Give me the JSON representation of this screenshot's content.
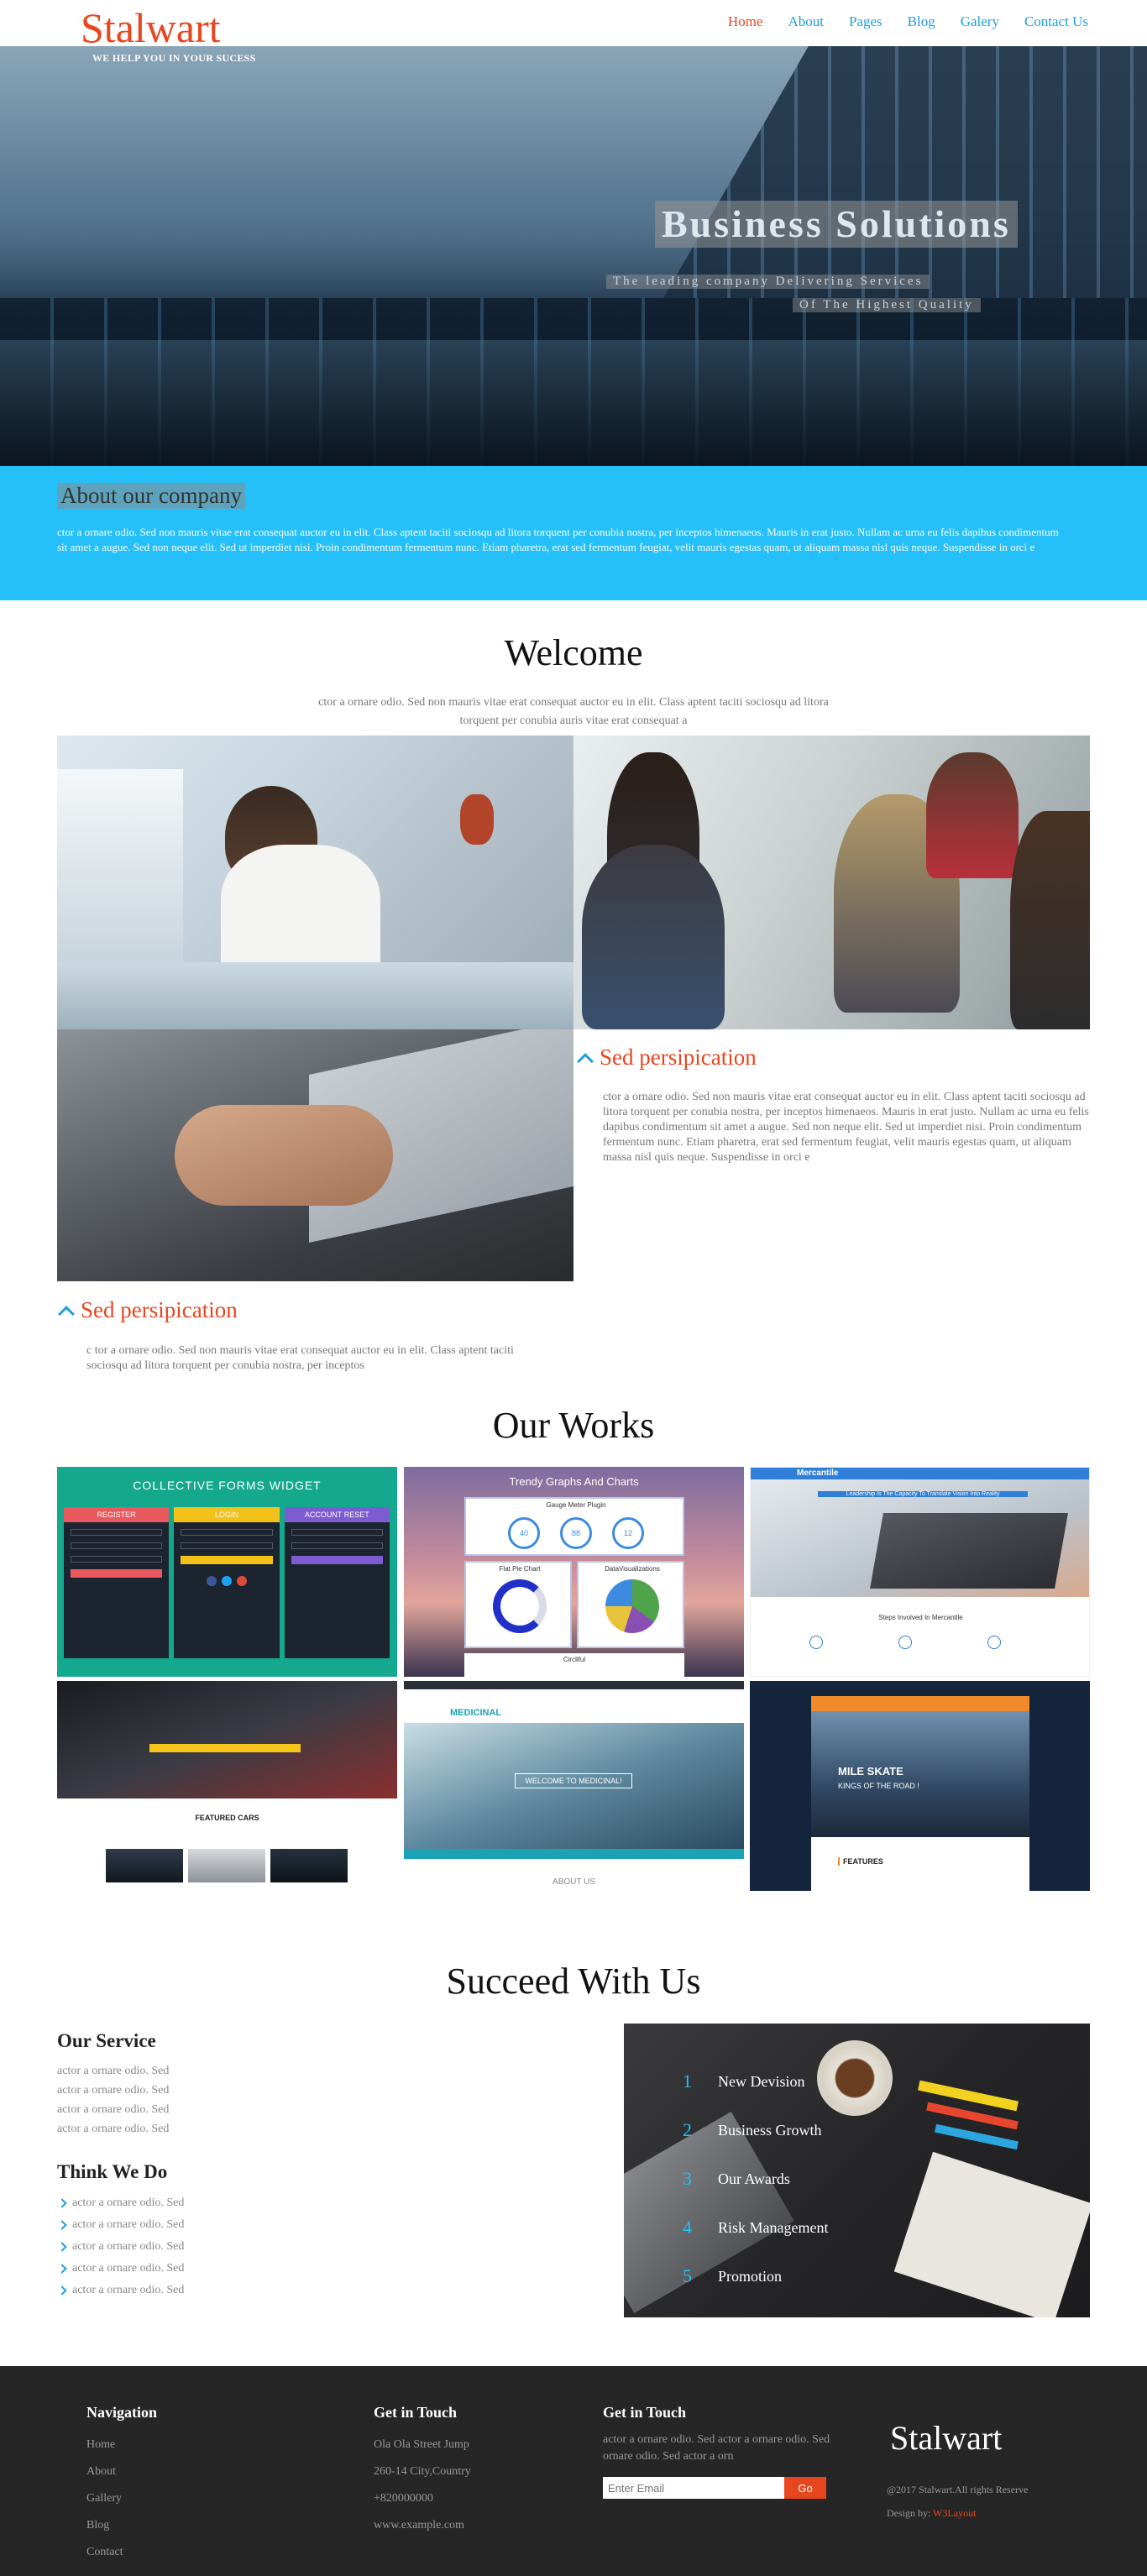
{
  "header": {
    "logo": "Stalwart",
    "tagline": "WE HELP YOU IN YOUR SUCESS",
    "nav": [
      "Home",
      "About",
      "Pages",
      "Blog",
      "Galery",
      "Contact Us"
    ]
  },
  "hero": {
    "title": "Business Solutions",
    "sub1": "The leading company Delivering Services",
    "sub2": "Of The Highest Quality"
  },
  "about": {
    "title": "About our company",
    "text": "ctor a ornare odio. Sed non mauris vitae erat consequat auctor eu in elit. Class aptent taciti sociosqu ad litora torquent per conubia nostra, per inceptos himenaeos. Mauris in erat justo. Nullam ac urna eu felis dapibus condimentum sit amet a augue. Sed non neque elit. Sed ut imperdiet nisi. Proin condimentum fermentum nunc. Etiam pharetra, erat sed fermentum feugiat, velit mauris egestas quam, ut aliquam massa nisl quis neque. Suspendisse in orci e"
  },
  "welcome": {
    "title": "Welcome",
    "intro": "ctor a ornare odio. Sed non mauris vitae erat consequat auctor eu in elit. Class aptent taciti sociosqu ad litora torquent per conubia auris vitae erat consequat a",
    "feature1": {
      "title": "Sed persipication",
      "text": "ctor a ornare odio. Sed non mauris vitae erat consequat auctor eu in elit. Class aptent taciti sociosqu ad litora torquent per conubia nostra, per inceptos himenaeos. Mauris in erat justo. Nullam ac urna eu felis dapibus condimentum sit amet a augue. Sed non neque elit. Sed ut imperdiet nisi. Proin condimentum fermentum nunc. Etiam pharetra, erat sed fermentum feugiat, velit mauris egestas quam, ut aliquam massa nisl quis neque. Suspendisse in orci e"
    },
    "feature2": {
      "title": "Sed persipication",
      "text": "c tor a ornare odio. Sed non mauris vitae erat consequat auctor eu in elit. Class aptent taciti sociosqu ad litora torquent per conubia nostra, per inceptos"
    }
  },
  "works": {
    "title": "Our Works",
    "w1": {
      "heading": "COLLECTIVE FORMS WIDGET",
      "tabs": [
        "REGISTER",
        "LOGIN",
        "ACCOUNT RESET"
      ]
    },
    "w2": {
      "heading": "Trendy Graphs And Charts",
      "g1": "Gauge Meter Plugin",
      "g2": "Flat Pie Chart",
      "g3": "DataVisualizations",
      "g4": "Circliful",
      "v1": "40",
      "v2": "88",
      "v3": "12"
    },
    "w3": {
      "brand": "Mercantile",
      "tag": "Leadership Is The Capacity To Translate Vision Into Reality",
      "sub": "Steps Involved In Mercantile"
    },
    "w4": {
      "heading": "FEATURED CARS"
    },
    "w5": {
      "brand": "MEDICINAL",
      "banner": "WELCOME TO MEDICINAL!",
      "about": "ABOUT US"
    },
    "w6": {
      "brand": "MILE SKATE",
      "sub": "KINGS OF THE ROAD !",
      "features": "FEATURES"
    }
  },
  "succeed": {
    "title": "Succeed With Us",
    "service_title": "Our Service",
    "services": [
      "actor a ornare odio. Sed",
      "actor a ornare odio. Sed",
      "actor a ornare odio. Sed",
      "actor a ornare odio. Sed"
    ],
    "think_title": "Think We Do",
    "things": [
      "actor a ornare odio. Sed",
      "actor a ornare odio. Sed",
      "actor a ornare odio. Sed",
      "actor a ornare odio. Sed",
      "actor a ornare odio. Sed"
    ],
    "list": [
      {
        "n": "1",
        "label": "New Devision"
      },
      {
        "n": "2",
        "label": "Business Growth"
      },
      {
        "n": "3",
        "label": "Our Awards"
      },
      {
        "n": "4",
        "label": "Risk Management"
      },
      {
        "n": "5",
        "label": "Promotion"
      }
    ]
  },
  "footer": {
    "nav_title": "Navigation",
    "nav": [
      "Home",
      "About",
      "Gallery",
      "Blog",
      "Contact"
    ],
    "touch_title": "Get in Touch",
    "address": [
      "Ola Ola Street Jump",
      "260-14 City,Country",
      "+820000000",
      "www.example.com"
    ],
    "touch2_title": "Get in Touch",
    "touch2_text": "actor a ornare odio. Sed actor a ornare odio. Sed ornare odio. Sed actor a orn",
    "email_placeholder": "Enter Email",
    "go": "Go",
    "logo": "Stalwart",
    "copyright": "@2017 Stalwart.All rights Reserve",
    "design_label": "Design by:",
    "design_by": "W3Layout"
  },
  "colors": {
    "accent": "#e8461e",
    "blue": "#1e9ee0",
    "sky": "#25bff9",
    "footer": "#262626"
  }
}
